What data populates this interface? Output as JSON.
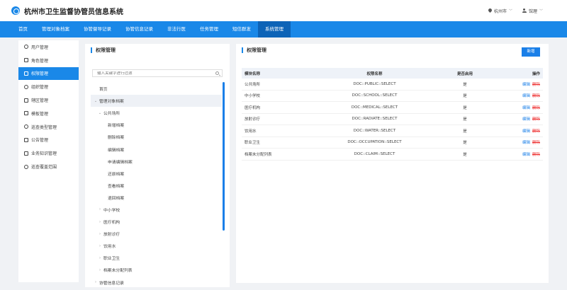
{
  "header": {
    "app_title": "杭州市卫生监督协管员信息系统",
    "location": "杭州市",
    "user": "馆理"
  },
  "nav": {
    "items": [
      "首页",
      "管理对象档案",
      "协管督导记录",
      "协管信息记录",
      "非法行医",
      "任务管理",
      "短信群发",
      "系统管理"
    ],
    "active_index": 7
  },
  "sidebar": {
    "items": [
      "用户管理",
      "角色管理",
      "权限管理",
      "组织管理",
      "辖区管理",
      "模板管理",
      "巡查类型管理",
      "公告管理",
      "业务知识管理",
      "巡查覆盖范围"
    ],
    "active_index": 2
  },
  "tree_panel": {
    "title": "权限管理",
    "search_placeholder": "输入关键字进行过滤",
    "nodes": [
      {
        "label": "首页",
        "level": 0,
        "arrow": ""
      },
      {
        "label": "管理对象档案",
        "level": 0,
        "arrow": "⌄",
        "selected": true
      },
      {
        "label": "公共场所",
        "level": 1,
        "arrow": "⌄"
      },
      {
        "label": "新增档案",
        "level": 2,
        "arrow": ""
      },
      {
        "label": "删除档案",
        "level": 2,
        "arrow": ""
      },
      {
        "label": "编辑档案",
        "level": 2,
        "arrow": ""
      },
      {
        "label": "申请编辑档案",
        "level": 2,
        "arrow": ""
      },
      {
        "label": "还原档案",
        "level": 2,
        "arrow": ""
      },
      {
        "label": "查看档案",
        "level": 2,
        "arrow": ""
      },
      {
        "label": "退回档案",
        "level": 2,
        "arrow": ""
      },
      {
        "label": "中小学校",
        "level": 1,
        "arrow": "›"
      },
      {
        "label": "医疗机构",
        "level": 1,
        "arrow": "›"
      },
      {
        "label": "放射诊疗",
        "level": 1,
        "arrow": "›"
      },
      {
        "label": "饮用水",
        "level": 1,
        "arrow": "›"
      },
      {
        "label": "职业卫生",
        "level": 1,
        "arrow": "›"
      },
      {
        "label": "档案未分配列表",
        "level": 1,
        "arrow": "›"
      },
      {
        "label": "协管信息记录",
        "level": 0,
        "arrow": "›"
      }
    ]
  },
  "perm_panel": {
    "title": "权限管理",
    "new_button": "新增",
    "columns": [
      "模块名称",
      "权限名称",
      "是否启用",
      "操作"
    ],
    "edit_label": "编辑",
    "delete_label": "删除",
    "rows": [
      {
        "module": "公共场所",
        "perm": "DOC::PUBLIC::SELECT",
        "enabled": "是"
      },
      {
        "module": "中小学校",
        "perm": "DOC::SCHOOL::SELECT",
        "enabled": "是"
      },
      {
        "module": "医疗机构",
        "perm": "DOC::MEDICAL::SELECT",
        "enabled": "是"
      },
      {
        "module": "放射诊疗",
        "perm": "DOC::RADIATE::SELECT",
        "enabled": "是"
      },
      {
        "module": "饮用水",
        "perm": "DOC::WATER::SELECT",
        "enabled": "是"
      },
      {
        "module": "职业卫生",
        "perm": "DOC::OCCUPATION::SELECT",
        "enabled": "是"
      },
      {
        "module": "档案未分配列表",
        "perm": "DOC::CLAIM::SELECT",
        "enabled": "是"
      }
    ]
  },
  "colors": {
    "primary": "#1a88e8",
    "nav_active": "#0d63b7",
    "delete": "#ee3333"
  }
}
